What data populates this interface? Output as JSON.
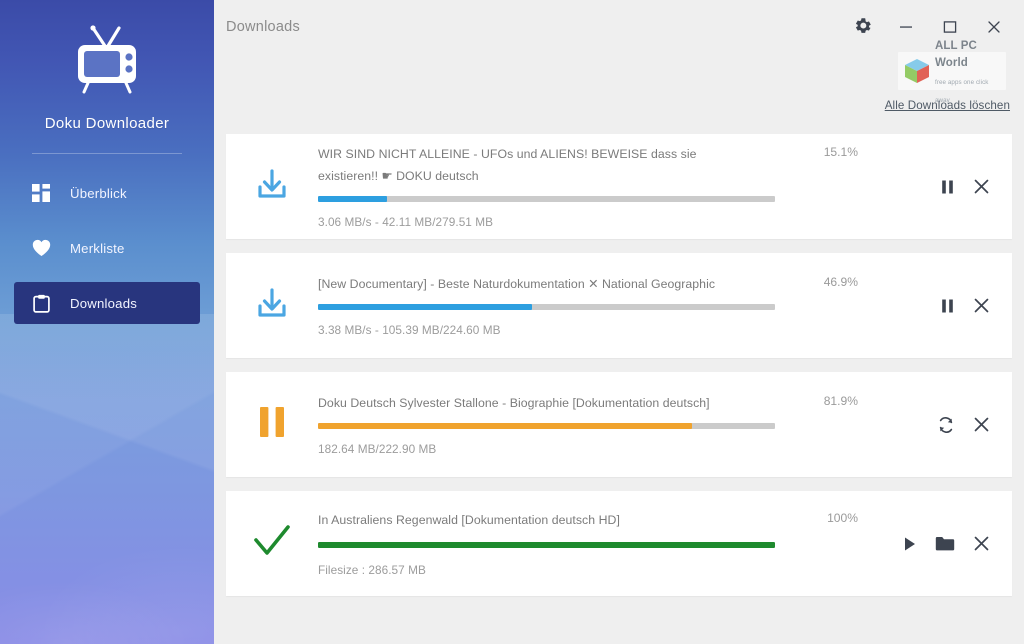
{
  "app": {
    "brand_name": "Doku Downloader",
    "logo_icon": "tv-icon"
  },
  "sidebar": {
    "items": [
      {
        "label": "Überblick",
        "icon": "dashboard-grid-icon",
        "active": false
      },
      {
        "label": "Merkliste",
        "icon": "heart-icon",
        "active": false
      },
      {
        "label": "Downloads",
        "icon": "clipboard-icon",
        "active": true
      }
    ]
  },
  "header": {
    "title": "Downloads",
    "window_controls": [
      {
        "name": "settings-button",
        "icon": "gear-icon"
      },
      {
        "name": "minimize-button",
        "icon": "minimize-icon"
      },
      {
        "name": "maximize-button",
        "icon": "maximize-icon"
      },
      {
        "name": "close-button",
        "icon": "close-icon"
      }
    ],
    "clear_all_label": "Alle Downloads löschen"
  },
  "watermark": {
    "title": "ALL PC World",
    "subtitle": "free apps one click away",
    "icon": "cube-logo-icon"
  },
  "colors": {
    "accent_blue": "#2d9fe0",
    "orange": "#f0a32e",
    "green": "#1e8a2e",
    "track_gray": "#cbcbcb",
    "sidebar_active": "#28357e"
  },
  "downloads": [
    {
      "status_icon": "download-icon",
      "status_color": "#4ba6e2",
      "title": "WIR SIND NICHT ALLEINE - UFOs und ALIENS! BEWEISE dass sie existieren!! ☛ DOKU deutsch",
      "percent_label": "15.1%",
      "percent": 15.1,
      "bar_color": "#2d9fe0",
      "meta": "3.06 MB/s - 42.11 MB/279.51 MB",
      "actions": [
        {
          "name": "pause-button",
          "icon": "pause-icon"
        },
        {
          "name": "cancel-button",
          "icon": "close-icon"
        }
      ]
    },
    {
      "status_icon": "download-icon",
      "status_color": "#4ba6e2",
      "title": "[New Documentary] - Beste Naturdokumentation ✕ National Geographic",
      "percent_label": "46.9%",
      "percent": 46.9,
      "bar_color": "#2d9fe0",
      "meta": "3.38 MB/s - 105.39 MB/224.60 MB",
      "actions": [
        {
          "name": "pause-button",
          "icon": "pause-icon"
        },
        {
          "name": "cancel-button",
          "icon": "close-icon"
        }
      ]
    },
    {
      "status_icon": "pause-icon",
      "status_color": "#f0a32e",
      "title": "Doku Deutsch Sylvester Stallone - Biographie [Dokumentation deutsch]",
      "percent_label": "81.9%",
      "percent": 81.9,
      "bar_color": "#f0a32e",
      "meta": "182.64 MB/222.90 MB",
      "actions": [
        {
          "name": "resume-button",
          "icon": "refresh-icon"
        },
        {
          "name": "cancel-button",
          "icon": "close-icon"
        }
      ]
    },
    {
      "status_icon": "check-icon",
      "status_color": "#1e8a2e",
      "title": "In Australiens Regenwald [Dokumentation deutsch HD]",
      "percent_label": "100%",
      "percent": 100,
      "bar_color": "#1e8a2e",
      "meta": "Filesize : 286.57 MB",
      "actions": [
        {
          "name": "play-button",
          "icon": "play-icon"
        },
        {
          "name": "open-folder-button",
          "icon": "folder-icon"
        },
        {
          "name": "remove-button",
          "icon": "close-icon"
        }
      ]
    }
  ]
}
